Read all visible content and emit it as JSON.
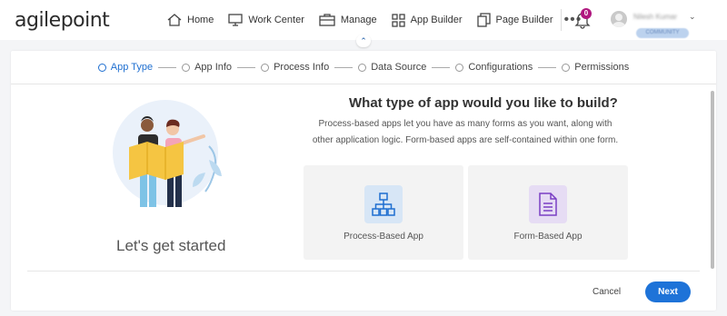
{
  "app": {
    "logo_text": "agilepoint"
  },
  "nav": {
    "items": [
      {
        "label": "Home",
        "icon": "home-icon"
      },
      {
        "label": "Work Center",
        "icon": "monitor-icon"
      },
      {
        "label": "Manage",
        "icon": "briefcase-icon"
      },
      {
        "label": "App Builder",
        "icon": "grid-icon"
      },
      {
        "label": "Page Builder",
        "icon": "pages-icon"
      }
    ],
    "more_label": "•••"
  },
  "user": {
    "notification_count": "0",
    "name": "Nilesh Kumar",
    "role": "COMMUNITY"
  },
  "wizard": {
    "steps": [
      {
        "label": "App Type",
        "active": true
      },
      {
        "label": "App Info",
        "active": false
      },
      {
        "label": "Process Info",
        "active": false
      },
      {
        "label": "Data Source",
        "active": false
      },
      {
        "label": "Configurations",
        "active": false
      },
      {
        "label": "Permissions",
        "active": false
      }
    ]
  },
  "content": {
    "start_text": "Let's get started",
    "title": "What type of app would you like to build?",
    "description": "Process-based apps let you have as many forms as you want, along with other application logic. Form-based apps are self-contained within one form.",
    "options": [
      {
        "label": "Process-Based App",
        "icon": "process-flow-icon",
        "tint": "#d7e6f6"
      },
      {
        "label": "Form-Based App",
        "icon": "form-document-icon",
        "tint": "#e6dcf4"
      }
    ]
  },
  "footer": {
    "cancel_label": "Cancel",
    "next_label": "Next"
  },
  "colors": {
    "accent": "#1e73d8",
    "badge": "#b0187f"
  }
}
